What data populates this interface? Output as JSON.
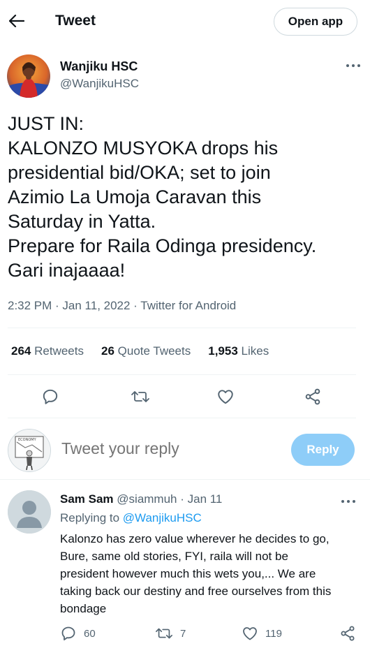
{
  "header": {
    "title": "Tweet",
    "open_app_label": "Open app",
    "back_icon": "arrow-left-icon"
  },
  "author": {
    "name": "Wanjiku HSC",
    "handle": "@WanjikuHSC",
    "more_icon": "more-horizontal-icon"
  },
  "tweet": {
    "lines": [
      "JUST IN:",
      "KALONZO MUSYOKA drops his",
      "presidential bid/OKA; set to join",
      "Azimio La Umoja Caravan this",
      "Saturday in Yatta.",
      "Prepare for Raila Odinga presidency.",
      "Gari inajaaaa!"
    ],
    "meta": "2:32 PM · Jan 11, 2022 · Twitter for Android"
  },
  "stats": {
    "retweets_count": "264",
    "retweets_label": "Retweets",
    "quotes_count": "26",
    "quotes_label": "Quote Tweets",
    "likes_count": "1,953",
    "likes_label": "Likes"
  },
  "actions": {
    "icons": [
      "reply-icon",
      "retweet-icon",
      "like-icon",
      "share-icon"
    ]
  },
  "reply_box": {
    "placeholder": "Tweet your reply",
    "button_label": "Reply"
  },
  "reply": {
    "name": "Sam Sam",
    "handle_time": "@siammuh · Jan 11",
    "replying_prefix": "Replying to",
    "replying_handle": "@WanjikuHSC",
    "lines": [
      "Kalonzo has zero value wherever he decides to go,",
      "Bure, same old stories, FYI, raila will not be",
      "president however much this wets you,... We are",
      "taking back our destiny and free ourselves from this",
      "bondage"
    ],
    "reply_count": "60",
    "retweet_count": "7",
    "like_count": "119"
  },
  "colors": {
    "text": "#0f1419",
    "secondary": "#536471",
    "accent": "#1d9bf0",
    "reply_button": "#8ecdf8",
    "divider": "#eff3f4"
  }
}
